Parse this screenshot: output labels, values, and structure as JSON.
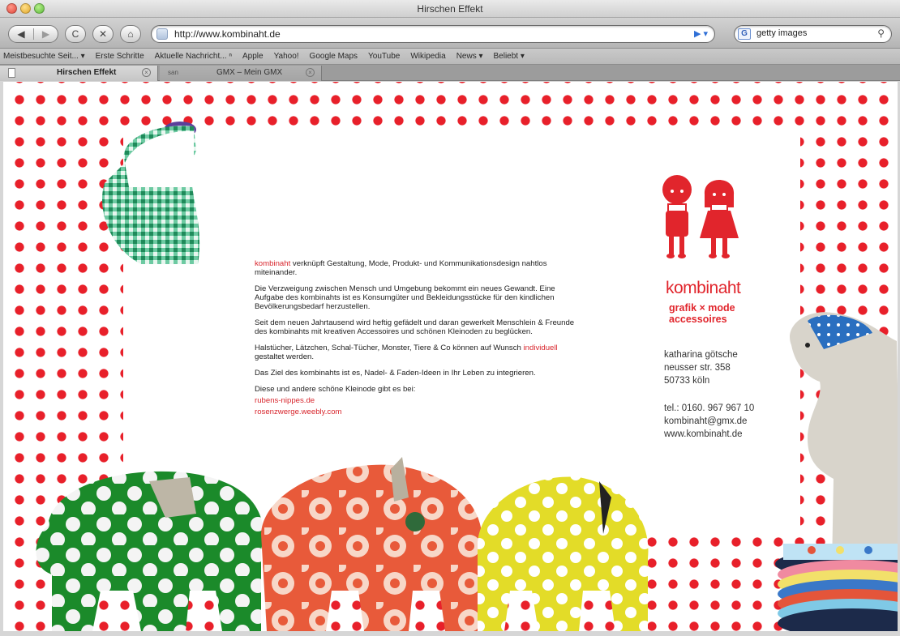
{
  "window": {
    "title": "Hirschen Effekt"
  },
  "toolbar": {
    "back_icon": "◀",
    "forward_icon": "▶",
    "reload_icon": "C",
    "stop_icon": "✕",
    "home_icon": "⌂",
    "url": "http://www.kombinaht.de",
    "go_icon": "▶ ▾",
    "search_engine_icon": "G",
    "search_text": "getty images",
    "search_icon": "⚲"
  },
  "bookmarks": [
    "Meistbesuchte Seit... ▾",
    "Erste Schritte",
    "Aktuelle Nachricht... ⁿ",
    "Apple",
    "Yahoo!",
    "Google Maps",
    "YouTube",
    "Wikipedia",
    "News ▾",
    "Beliebt ▾"
  ],
  "tabs": [
    {
      "label": "Hirschen Effekt",
      "close": "×"
    },
    {
      "label": "GMX – Mein GMX",
      "close": "×",
      "prefix": "san"
    }
  ],
  "content": {
    "intro_brand": "kombinaht",
    "intro_rest": " verknüpft Gestaltung, Mode, Produkt- und Kommunikationsdesign nahtlos miteinander.",
    "p2": "Die Verzweigung zwischen Mensch und Umgebung bekommt ein neues Gewandt. Eine Aufgabe des kombinahts ist es Konsumgüter und Bekleidungsstücke für den kindlichen Bevölkerungsbedarf herzustellen.",
    "p3": "Seit dem neuen Jahrtausend wird heftig gefädelt und daran gewerkelt Menschlein & Freunde des kombinahts mit kreativen Accessoires und schönen Kleinoden zu beglücken.",
    "p4_start": "Halstücher, Lätzchen, Schal-Tücher, Monster, Tiere & Co können auf Wunsch ",
    "p4_red": "individuell",
    "p4_end": " gestaltet werden.",
    "p5": "Das Ziel des kombinahts ist es, Nadel- & Faden-Ideen in Ihr Leben zu integrieren.",
    "p6": "Diese und andere schöne Kleinode gibt es bei:",
    "link1": "rubens-nippes.de",
    "link2": "rosenzwerge.weebly.com"
  },
  "brand": {
    "name": "kombinaht",
    "tagline1": "grafik × mode",
    "tagline2": "accessoires",
    "color": "#e1252c"
  },
  "contact": {
    "name": "katharina götsche",
    "street": "neusser str. 358",
    "city": "50733 köln",
    "phone": "tel.: 0160. 967 967 10",
    "email": "kombinaht@gmx.de",
    "web": "www.kombinaht.de"
  },
  "colors": {
    "dots": "#e8202a",
    "accent_red": "#d8262d"
  }
}
